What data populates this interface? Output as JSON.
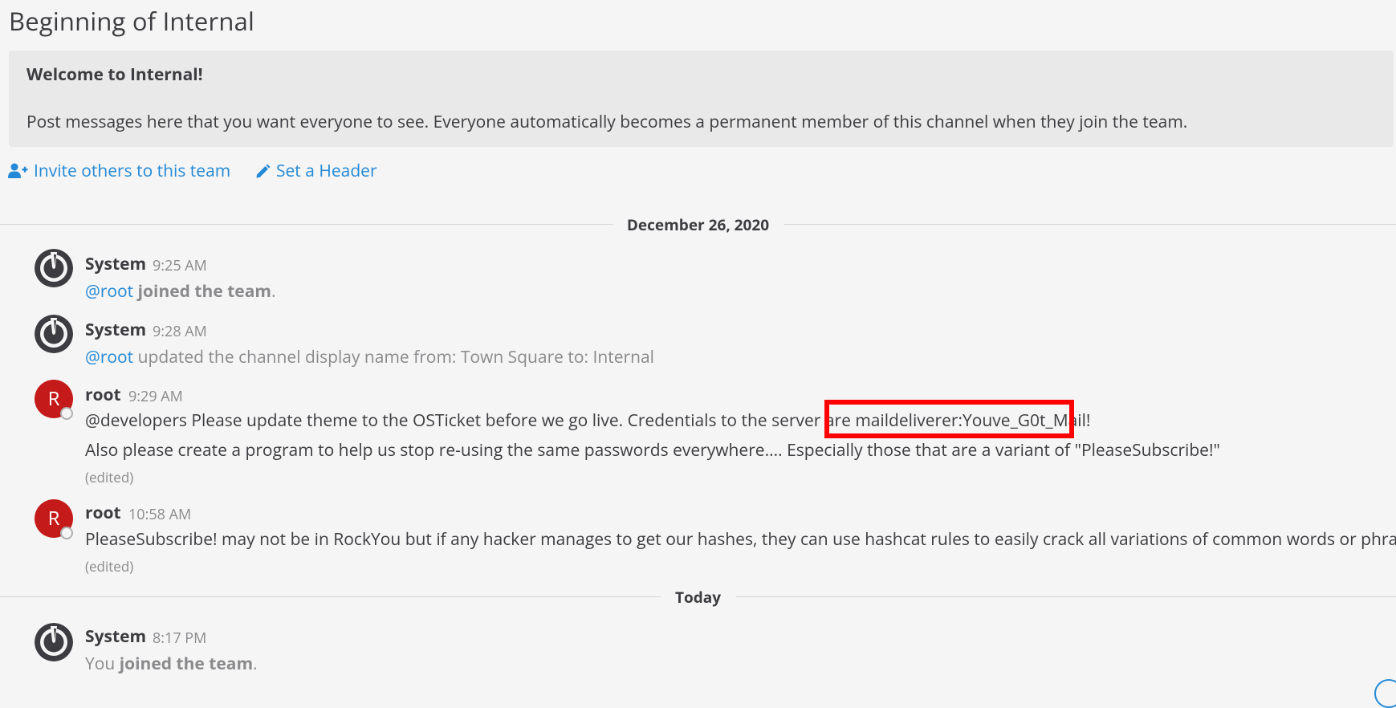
{
  "channel_intro": {
    "title": "Beginning of Internal",
    "welcome_title": "Welcome to Internal!",
    "welcome_text": "Post messages here that you want everyone to see. Everyone automatically becomes a permanent member of this channel when they join the team.",
    "invite_label": "Invite others to this team",
    "header_label": "Set a Header"
  },
  "date_separators": [
    "December 26, 2020",
    "Today"
  ],
  "posts": [
    {
      "username": "System",
      "time": "9:25 AM",
      "mention": "@root",
      "action": "joined the team",
      "suffix": "."
    },
    {
      "username": "System",
      "time": "9:28 AM",
      "mention": "@root",
      "text": " updated the channel display name from: Town Square to: Internal"
    },
    {
      "username": "root",
      "avatar_letter": "R",
      "time": "9:29 AM",
      "line1": "@developers Please update theme to the OSTicket before we go live.  Credentials to the server are maildeliverer:Youve_G0t_Mail!",
      "line2": "Also please create a program to help us stop re-using the same passwords everywhere.... Especially those that are a variant of \"PleaseSubscribe!\"",
      "edited": "(edited)"
    },
    {
      "username": "root",
      "avatar_letter": "R",
      "time": "10:58 AM",
      "line1": "PleaseSubscribe! may not be in RockYou but if any hacker manages to get our hashes, they can use hashcat rules to easily crack all variations of common words or phrases.",
      "edited": "(edited)"
    },
    {
      "username": "System",
      "time": "8:17 PM",
      "prefix": "You ",
      "action": "joined the team",
      "suffix": "."
    }
  ],
  "colors": {
    "link": "#2389d7",
    "avatar_root": "#c41a1a",
    "highlight_box": "#ff0000"
  }
}
